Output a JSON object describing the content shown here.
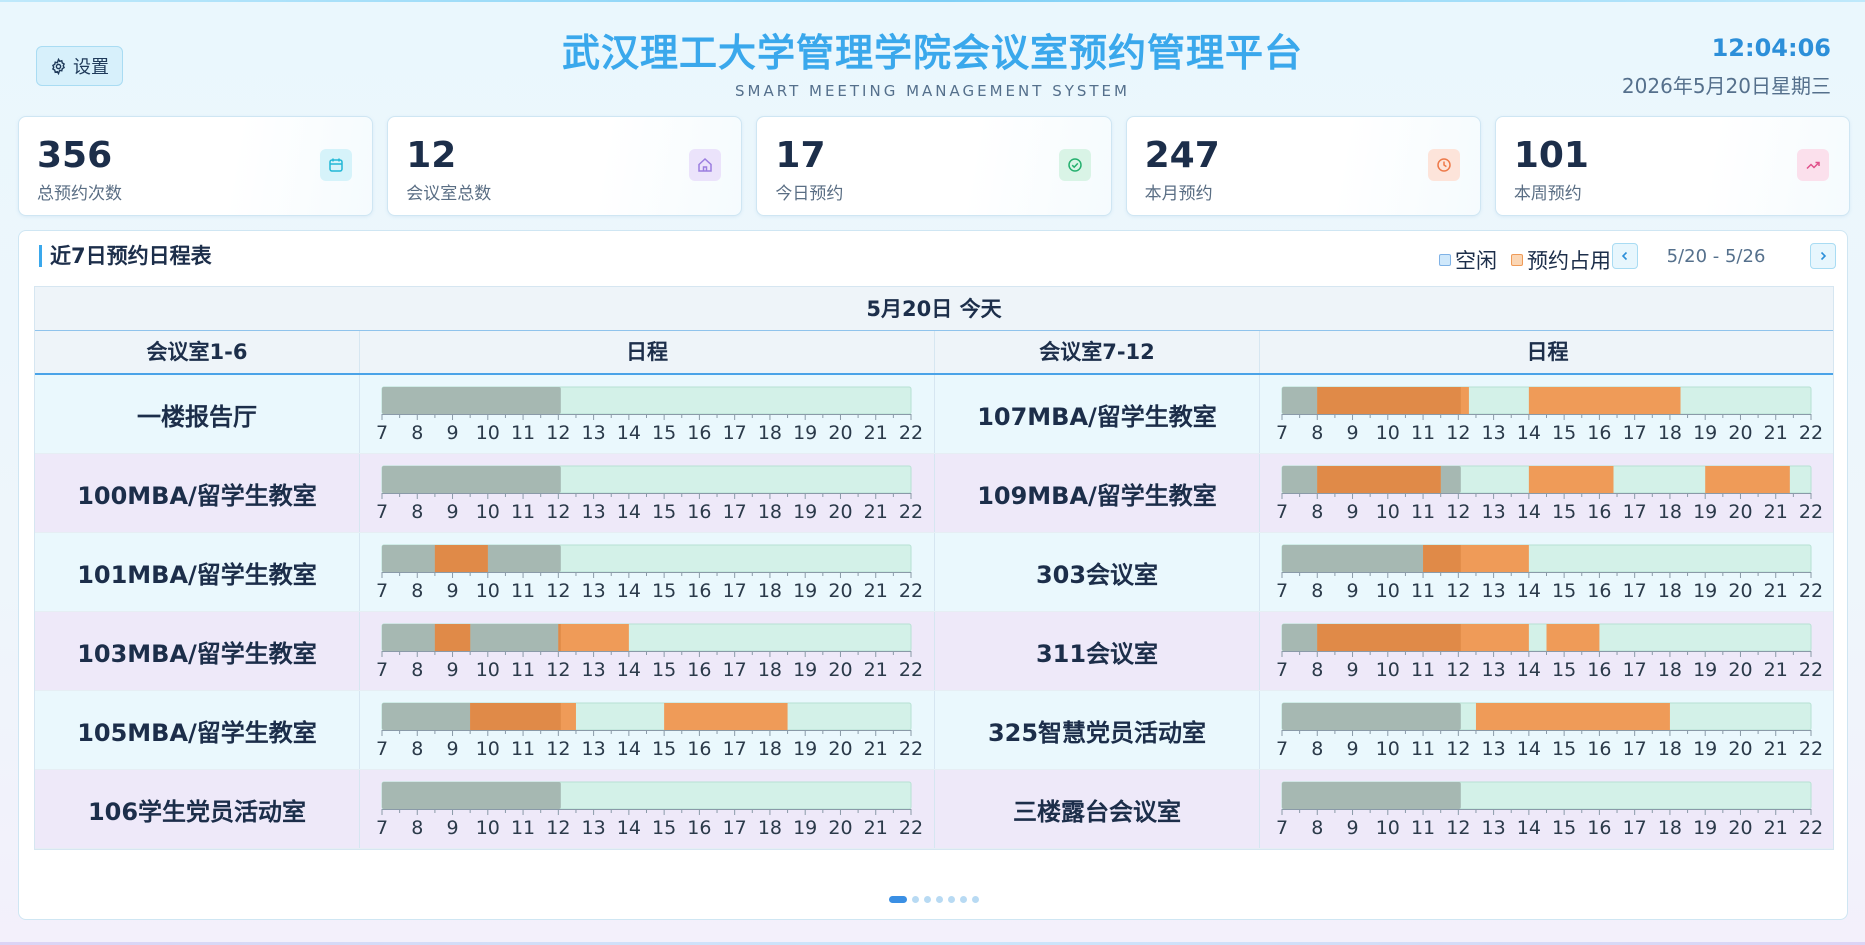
{
  "header": {
    "settings_label": "设置",
    "title": "武汉理工大学管理学院会议室预约管理平台",
    "subtitle": "SMART MEETING MANAGEMENT SYSTEM",
    "time": "12:04:06",
    "date": "2026年5月20日星期三"
  },
  "stats": [
    {
      "value": "356",
      "label": "总预约次数",
      "icon": "calendar-icon",
      "color": "#22b8d6",
      "bg": "#d6f3fa"
    },
    {
      "value": "12",
      "label": "会议室总数",
      "icon": "home-icon",
      "color": "#9b7ee0",
      "bg": "#ebe3fb"
    },
    {
      "value": "17",
      "label": "今日预约",
      "icon": "check-circle-icon",
      "color": "#26b06f",
      "bg": "#d9f4e6"
    },
    {
      "value": "247",
      "label": "本月预约",
      "icon": "clock-icon",
      "color": "#ee7a4a",
      "bg": "#fde4da"
    },
    {
      "value": "101",
      "label": "本周预约",
      "icon": "trend-up-icon",
      "color": "#e0508a",
      "bg": "#fbe0ec"
    }
  ],
  "schedule": {
    "title": "近7日预约日程表",
    "legend_free": "空闲",
    "legend_booked": "预约占用",
    "range": "5/20 - 5/26",
    "day_label": "5月20日 今天",
    "col_rooms_left": "会议室1-6",
    "col_sched": "日程",
    "col_rooms_right": "会议室7-12",
    "hours": [
      "7",
      "8",
      "9",
      "10",
      "11",
      "12",
      "13",
      "14",
      "15",
      "16",
      "17",
      "18",
      "19",
      "20",
      "21",
      "22"
    ],
    "hour_start": 7,
    "hour_end": 22,
    "now_hour": 12.07,
    "colors": {
      "past": "#a6b8b2",
      "free": "#d3f1e8",
      "booked": "#ef9b58",
      "booked_past": "#e08a48"
    },
    "rows": [
      {
        "left": {
          "name": "一楼报告厅",
          "bookings": []
        },
        "right": {
          "name": "107MBA/留学生教室",
          "bookings": [
            [
              8,
              12.3
            ],
            [
              14,
              18.3
            ]
          ]
        }
      },
      {
        "left": {
          "name": "100MBA/留学生教室",
          "bookings": []
        },
        "right": {
          "name": "109MBA/留学生教室",
          "bookings": [
            [
              8,
              11.5
            ],
            [
              14,
              16.4
            ],
            [
              19,
              21.4
            ]
          ]
        }
      },
      {
        "left": {
          "name": "101MBA/留学生教室",
          "bookings": [
            [
              8.5,
              10
            ]
          ]
        },
        "right": {
          "name": "303会议室",
          "bookings": [
            [
              11,
              14
            ]
          ]
        }
      },
      {
        "left": {
          "name": "103MBA/留学生教室",
          "bookings": [
            [
              8.5,
              9.5
            ],
            [
              12,
              14
            ]
          ]
        },
        "right": {
          "name": "311会议室",
          "bookings": [
            [
              8,
              14
            ],
            [
              14.5,
              16
            ]
          ]
        }
      },
      {
        "left": {
          "name": "105MBA/留学生教室",
          "bookings": [
            [
              9.5,
              12.5
            ],
            [
              15,
              18.5
            ]
          ]
        },
        "right": {
          "name": "325智慧党员活动室",
          "bookings": [
            [
              12.5,
              18
            ]
          ]
        }
      },
      {
        "left": {
          "name": "106学生党员活动室",
          "bookings": []
        },
        "right": {
          "name": "三楼露台会议室",
          "bookings": []
        }
      }
    ]
  },
  "pagination": {
    "pages": 7,
    "active": 0
  }
}
